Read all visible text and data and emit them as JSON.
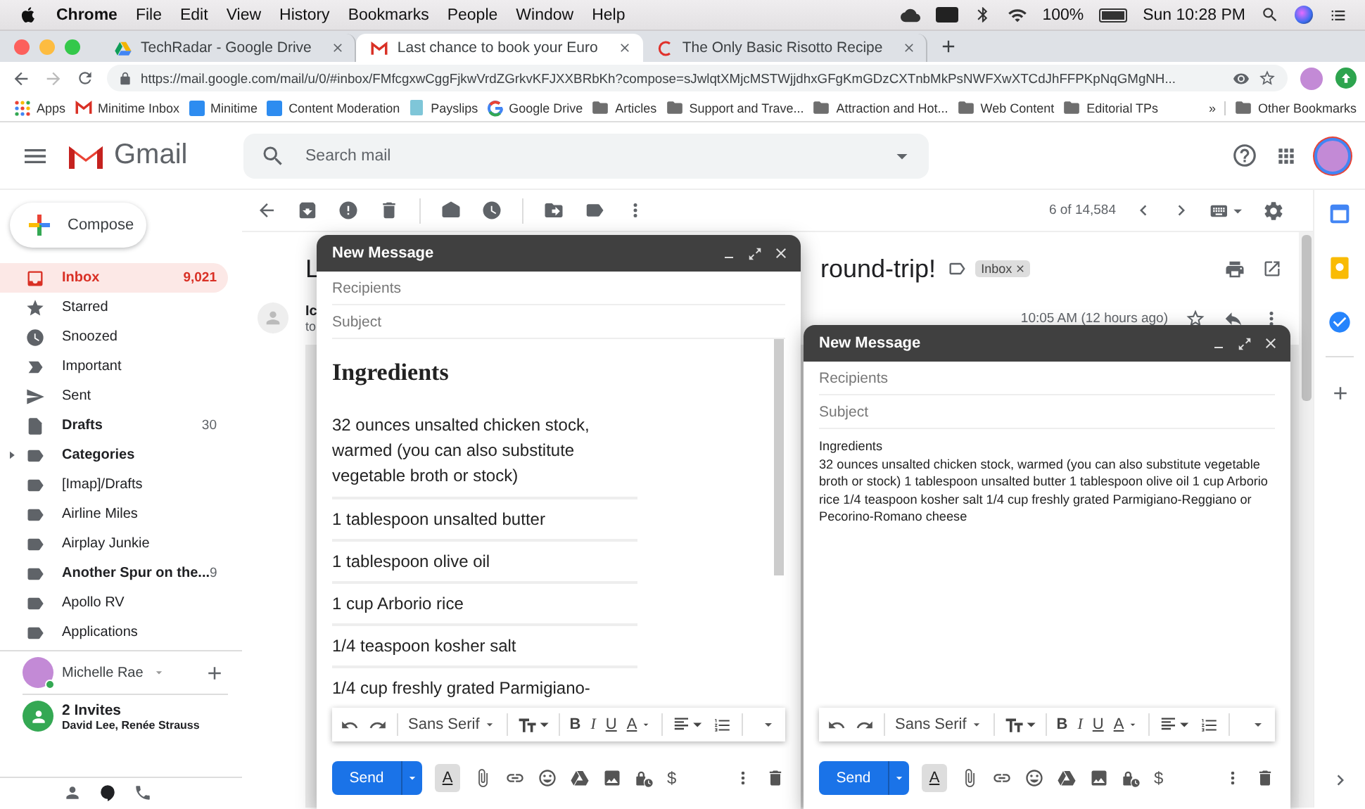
{
  "menubar": {
    "app": "Chrome",
    "menus": [
      "File",
      "Edit",
      "View",
      "History",
      "Bookmarks",
      "People",
      "Window",
      "Help"
    ],
    "battery": "100%",
    "clock": "Sun 10:28 PM"
  },
  "browser": {
    "tabs": [
      {
        "title": "TechRadar - Google Drive",
        "kind": "drive",
        "selected": false
      },
      {
        "title": "Last chance to book your Euro",
        "kind": "mail",
        "selected": true
      },
      {
        "title": "The Only Basic Risotto Recipe",
        "kind": "recipe",
        "selected": false
      }
    ],
    "url": "https://mail.google.com/mail/u/0/#inbox/FMfcgxwCggFjkwVrdZGrkvKFJXXBRbKh?compose=sJwlqtXMjcMSTWjjdhxGFgKmGDzCXTnbMkPsNWFXwXTCdJhFFPKpNqGMgNH...",
    "bookmarks": [
      {
        "label": "Apps",
        "kind": "apps"
      },
      {
        "label": "Minitime Inbox",
        "kind": "mail"
      },
      {
        "label": "Minitime",
        "kind": "tile"
      },
      {
        "label": "Content Moderation",
        "kind": "tile"
      },
      {
        "label": "Payslips",
        "kind": "page"
      },
      {
        "label": "Google Drive",
        "kind": "ring"
      },
      {
        "label": "Articles",
        "kind": "folder"
      },
      {
        "label": "Support and Trave...",
        "kind": "folder"
      },
      {
        "label": "Attraction and Hot...",
        "kind": "folder"
      },
      {
        "label": "Web Content",
        "kind": "folder"
      },
      {
        "label": "Editorial TPs",
        "kind": "folder"
      }
    ],
    "overflow": "»",
    "other": "Other Bookmarks"
  },
  "gmail": {
    "product": "Gmail",
    "search_placeholder": "Search mail",
    "compose": "Compose",
    "nav": [
      {
        "label": "Inbox",
        "count": "9,021",
        "kind": "inbox",
        "selected": true,
        "unread": true
      },
      {
        "label": "Starred",
        "kind": "star",
        "selected": false,
        "unread": false
      },
      {
        "label": "Snoozed",
        "kind": "clock",
        "selected": false,
        "unread": false
      },
      {
        "label": "Important",
        "kind": "important",
        "selected": false,
        "unread": false
      },
      {
        "label": "Sent",
        "kind": "send",
        "selected": false,
        "unread": false
      },
      {
        "label": "Drafts",
        "count": "30",
        "kind": "draft",
        "selected": false,
        "unread": true
      },
      {
        "label": "Categories",
        "kind": "label",
        "selected": false,
        "unread": true,
        "expanded": false
      },
      {
        "label": "[Imap]/Drafts",
        "kind": "label",
        "selected": false,
        "unread": false
      },
      {
        "label": "Airline Miles",
        "kind": "label",
        "selected": false,
        "unread": false
      },
      {
        "label": "Airplay Junkie",
        "kind": "label",
        "selected": false,
        "unread": false
      },
      {
        "label": "Another Spur on the...",
        "count": "9",
        "kind": "label",
        "selected": false,
        "unread": true
      },
      {
        "label": "Apollo RV",
        "kind": "label",
        "selected": false,
        "unread": false
      },
      {
        "label": "Applications",
        "kind": "label",
        "selected": false,
        "unread": false
      }
    ],
    "account": "Michelle Rae",
    "invites_title": "2 Invites",
    "invites_names": "David Lee, Renée Strauss"
  },
  "message": {
    "pager": "6 of 14,584",
    "subject_start": "L",
    "subject_end": "round-trip!",
    "label_chip": "Inbox",
    "sender": "Ic",
    "recipient_line": "to",
    "time": "10:05 AM (12 hours ago)"
  },
  "compose_windows": [
    {
      "title": "New Message",
      "recipients_placeholder": "Recipients",
      "subject_placeholder": "Subject",
      "kind": "formatted",
      "heading": "Ingredients",
      "items": [
        "32 ounces unsalted chicken stock, warmed (you can also substitute vegetable broth or stock)",
        "1 tablespoon unsalted butter",
        "1 tablespoon olive oil",
        "1 cup Arborio rice",
        "1/4 teaspoon kosher salt",
        "1/4 cup freshly grated Parmigiano-"
      ],
      "font": "Sans Serif",
      "format_glyphs": [
        "B",
        "I",
        "U",
        "A"
      ],
      "send": "Send",
      "formatting_toggle": "A",
      "currency": "$"
    },
    {
      "title": "New Message",
      "recipients_placeholder": "Recipients",
      "subject_placeholder": "Subject",
      "kind": "plain",
      "lines": [
        "Ingredients",
        "32 ounces unsalted chicken stock, warmed (you can also substitute vegetable broth or stock) 1 tablespoon unsalted butter 1 tablespoon olive oil 1 cup Arborio rice 1/4 teaspoon kosher salt 1/4 cup freshly grated Parmigiano-Reggiano or Pecorino-Romano cheese"
      ],
      "font": "Sans Serif",
      "format_glyphs": [
        "B",
        "I",
        "U",
        "A"
      ],
      "send": "Send",
      "formatting_toggle": "A",
      "currency": "$"
    }
  ]
}
